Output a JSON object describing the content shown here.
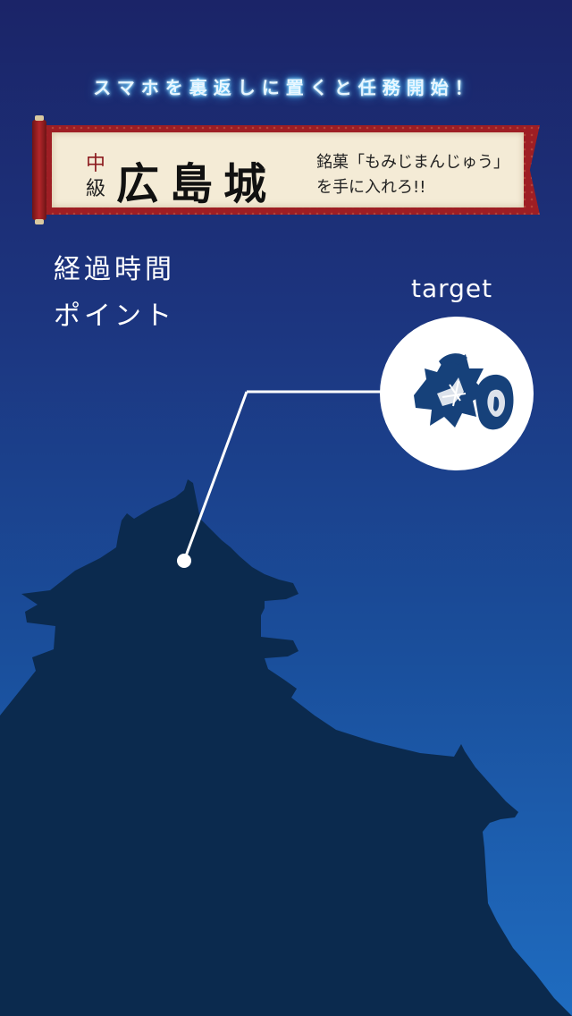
{
  "header": {
    "instruction": "スマホを裏返しに置くと任務開始！"
  },
  "banner": {
    "level_top": "中",
    "level_bottom": "級",
    "castle_name": "広島城",
    "mission_line1": "銘菓「もみじまんじゅう」",
    "mission_line2": "を手に入れろ!!"
  },
  "stats": {
    "elapsed_label": "経過時間",
    "points_label": "ポイント"
  },
  "target": {
    "label": "target",
    "icon": "momiji-manju-icon"
  },
  "colors": {
    "sky_top": "#1b2468",
    "sky_bottom": "#1f6cc0",
    "castle_silhouette": "#0b2a4e",
    "banner_red": "#9e1e24",
    "paper": "#f4ebd6",
    "glow": "#5fd0ff"
  }
}
